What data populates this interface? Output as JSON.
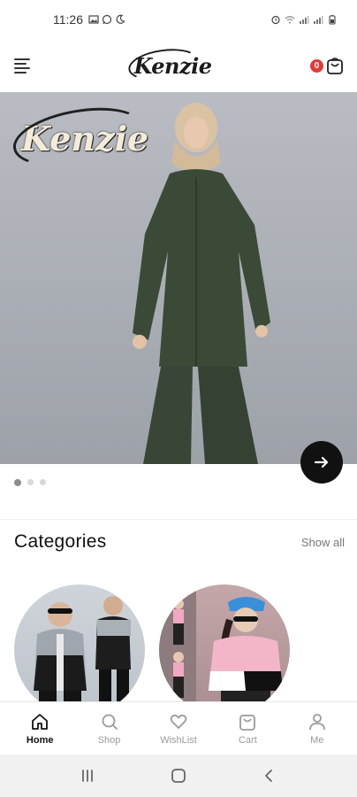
{
  "status_bar": {
    "time": "11:26",
    "icons": [
      "image-icon",
      "whatsapp-icon",
      "moon-icon"
    ],
    "right_icons": [
      "alarm-icon",
      "wifi-icon",
      "signal-icon",
      "signal-icon",
      "battery-icon"
    ]
  },
  "header": {
    "logo_text": "Kenzie",
    "cart_count": "0"
  },
  "banner": {
    "logo_text": "Kenzie",
    "slide_count": 3,
    "active_slide": 0,
    "bg_color": "#a8acb3"
  },
  "categories": {
    "title": "Categories",
    "show_all": "Show all"
  },
  "bottom_nav": {
    "items": [
      {
        "label": "Home",
        "icon": "home-icon",
        "active": true
      },
      {
        "label": "Shop",
        "icon": "search-icon",
        "active": false
      },
      {
        "label": "WishList",
        "icon": "heart-icon",
        "active": false
      },
      {
        "label": "Cart",
        "icon": "bag-icon",
        "active": false
      },
      {
        "label": "Me",
        "icon": "person-icon",
        "active": false
      }
    ]
  },
  "colors": {
    "badge": "#e53935",
    "accent_dark": "#111111",
    "inactive_nav": "#9a9a9a"
  }
}
